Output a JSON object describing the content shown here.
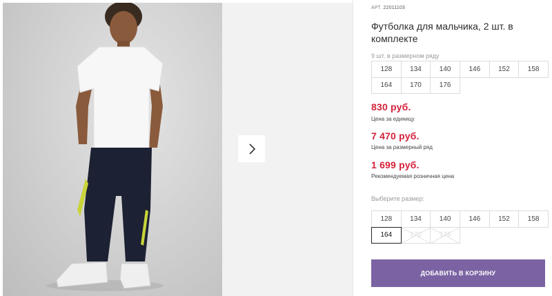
{
  "product": {
    "art_label": "АРТ.",
    "art_number": "22011103",
    "title": "Футболка для мальчика, 2 шт. в комплекте",
    "row_label": "9 шт. в размерном ряду",
    "row_sizes": [
      "128",
      "134",
      "140",
      "146",
      "152",
      "158",
      "164",
      "170",
      "176"
    ],
    "prices": [
      {
        "value": "830 руб.",
        "caption": "Цена за единицу"
      },
      {
        "value": "7 470 руб.",
        "caption": "Цена за размерный ряд"
      },
      {
        "value": "1 699 руб.",
        "caption": "Рекомендуемая розничная цена"
      }
    ],
    "choose_label": "Выберите размер:",
    "size_options": [
      {
        "label": "128",
        "state": "available"
      },
      {
        "label": "134",
        "state": "available"
      },
      {
        "label": "140",
        "state": "available"
      },
      {
        "label": "146",
        "state": "available"
      },
      {
        "label": "152",
        "state": "available"
      },
      {
        "label": "158",
        "state": "available"
      },
      {
        "label": "164",
        "state": "selected"
      },
      {
        "label": "170",
        "state": "unavailable"
      },
      {
        "label": "176",
        "state": "unavailable"
      }
    ],
    "add_to_cart": "ДОБАВИТЬ В КОРЗИНУ"
  },
  "gallery": {
    "next_icon": "chevron-right-icon"
  },
  "colors": {
    "price": "#d4203a",
    "button": "#7b63a3"
  }
}
